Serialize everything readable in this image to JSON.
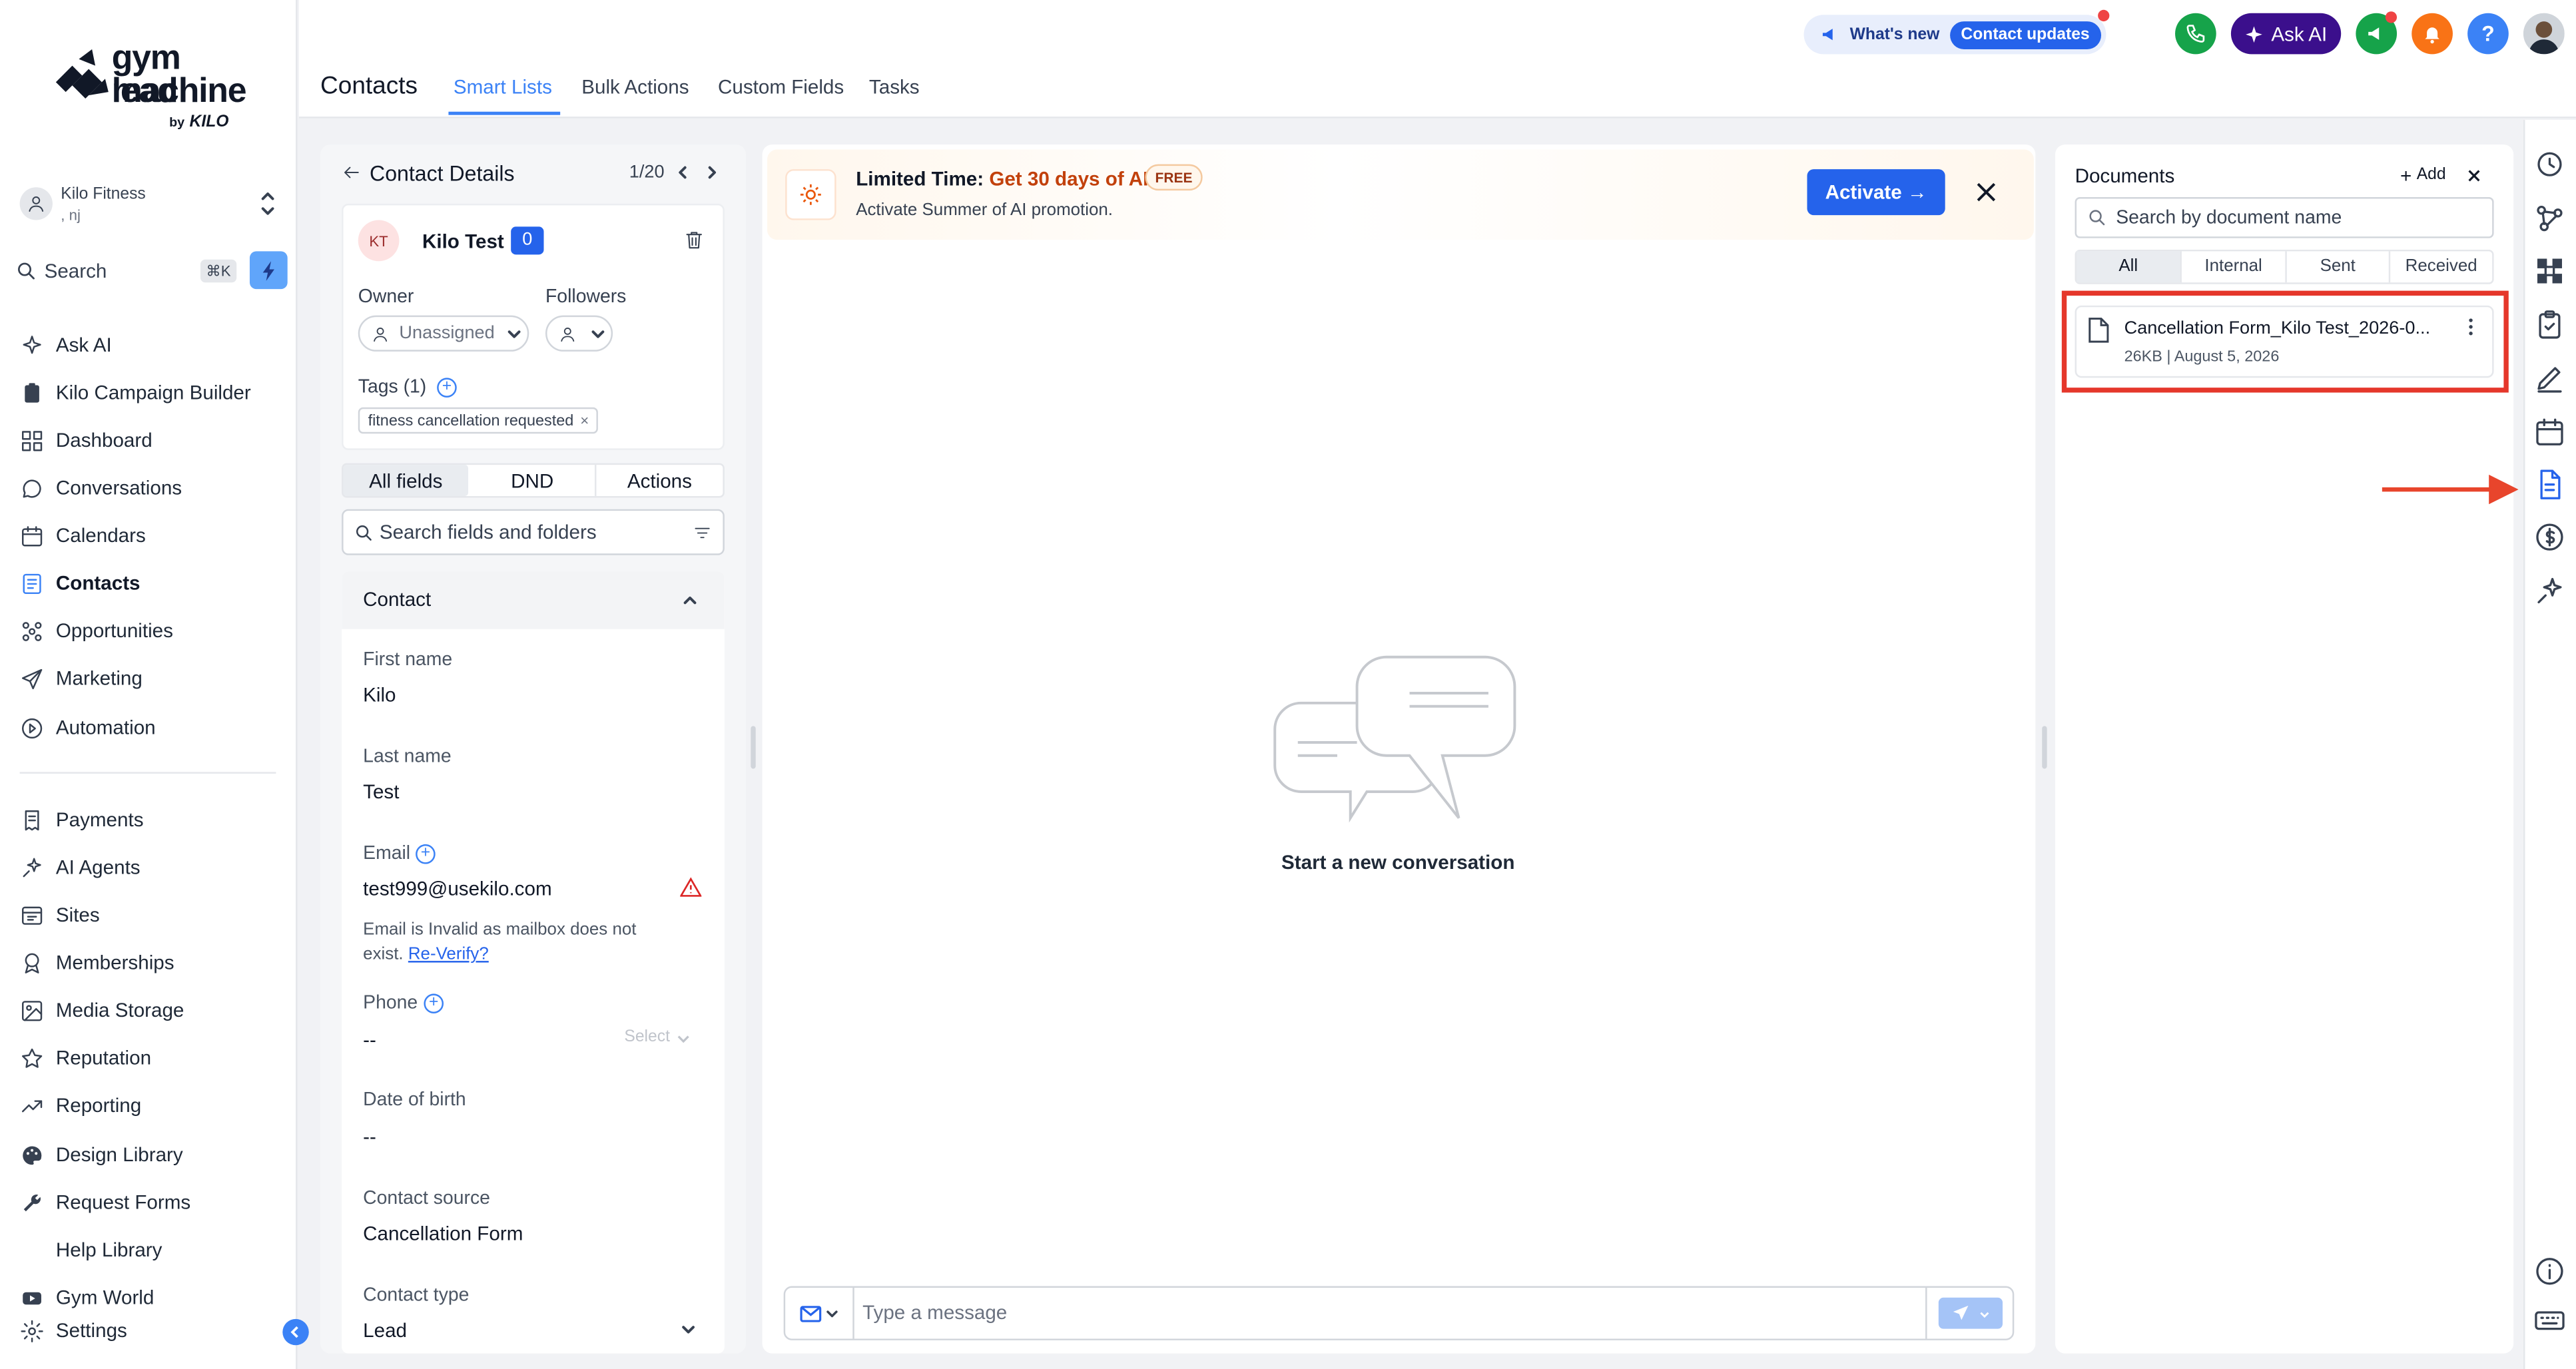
{
  "brand": {
    "line1": "gym lead",
    "line2": "machine",
    "by": "by",
    "kilo": "KILO"
  },
  "account": {
    "name": "Kilo Fitness",
    "sub": ", nj"
  },
  "search": {
    "label": "Search",
    "shortcut": "⌘K"
  },
  "nav": {
    "ask_ai": "Ask AI",
    "campaign_builder": "Kilo Campaign Builder",
    "dashboard": "Dashboard",
    "conversations": "Conversations",
    "calendars": "Calendars",
    "contacts": "Contacts",
    "opportunities": "Opportunities",
    "marketing": "Marketing",
    "automation": "Automation",
    "payments": "Payments",
    "ai_agents": "AI Agents",
    "sites": "Sites",
    "memberships": "Memberships",
    "media_storage": "Media Storage",
    "reputation": "Reputation",
    "reporting": "Reporting",
    "design_library": "Design Library",
    "request_forms": "Request Forms",
    "help_library": "Help Library",
    "gym_world": "Gym World",
    "settings": "Settings"
  },
  "header": {
    "title": "Contacts",
    "tabs": [
      "Smart Lists",
      "Bulk Actions",
      "Custom Fields",
      "Tasks"
    ],
    "whats_new": "What's new",
    "contact_updates": "Contact updates",
    "ask_ai": "Ask AI",
    "help": "?"
  },
  "contact_details": {
    "title": "Contact Details",
    "pager": "1/20",
    "initials": "KT",
    "name": "Kilo Test",
    "badge": "0",
    "owner_label": "Owner",
    "owner_value": "Unassigned",
    "followers_label": "Followers",
    "tags_label": "Tags (1)",
    "tag": "fitness cancellation requested",
    "tag_remove": "×",
    "segments": [
      "All fields",
      "DND",
      "Actions"
    ],
    "search_placeholder": "Search fields and folders",
    "section": "Contact",
    "first_name_label": "First name",
    "first_name": "Kilo",
    "last_name_label": "Last name",
    "last_name": "Test",
    "email_label": "Email",
    "email": "test999@usekilo.com",
    "email_warning": "Email is Invalid as mailbox does not exist.",
    "reverify": "Re-Verify?",
    "phone_label": "Phone",
    "phone": "--",
    "phone_select": "Select",
    "dob_label": "Date of birth",
    "dob": "--",
    "source_label": "Contact source",
    "source": "Cancellation Form",
    "type_label": "Contact type",
    "type": "Lead"
  },
  "promo": {
    "title_prefix": "Limited Time: ",
    "title_highlight": "Get 30 days of AI",
    "badge": "FREE",
    "subtitle": "Activate Summer of AI promotion.",
    "button": "Activate →"
  },
  "conversation": {
    "empty": "Start a new conversation",
    "message_placeholder": "Type a message"
  },
  "documents": {
    "title": "Documents",
    "add": "Add",
    "search_placeholder": "Search by document name",
    "tabs": [
      "All",
      "Internal",
      "Sent",
      "Received"
    ],
    "item_name": "Cancellation Form_Kilo Test_2026-0...",
    "item_meta": "26KB | August 5, 2026"
  },
  "colors": {
    "accent": "#2563eb",
    "highlight_box": "#e5372b",
    "arrow": "#e8452c",
    "promo_text": "#c2410c"
  }
}
